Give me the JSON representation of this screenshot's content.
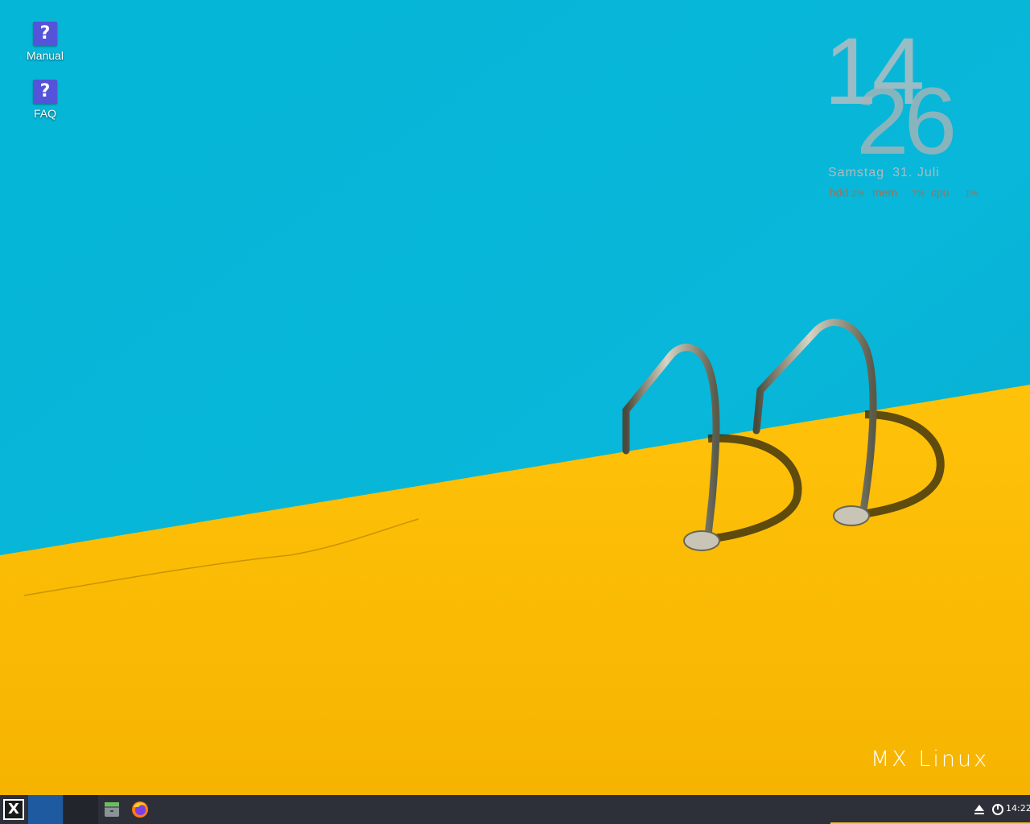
{
  "desktop": {
    "icons": [
      {
        "label": "Manual",
        "glyph": "?"
      },
      {
        "label": "FAQ",
        "glyph": "?"
      }
    ],
    "watermark": "MX Linux"
  },
  "conky": {
    "hour": "14",
    "minute": "26",
    "weekday": "Samstag",
    "date": "31. Juli",
    "stats": {
      "hdd_label": "hdd",
      "hdd_value": "2%",
      "mem_label": "mem",
      "mem_value": "7%",
      "cpu_label": "cpu",
      "cpu_value": "1%"
    }
  },
  "taskbar": {
    "start_glyph": "X",
    "clock": "14:22",
    "colors": {
      "bar": "#2d3038",
      "active_workspace": "#1e5aa0",
      "accent": "#f1c232"
    }
  },
  "icons": {
    "start": "mx-logo-icon",
    "file_manager": "file-manager-icon",
    "browser": "firefox-icon",
    "eject": "eject-icon",
    "power": "power-icon"
  }
}
